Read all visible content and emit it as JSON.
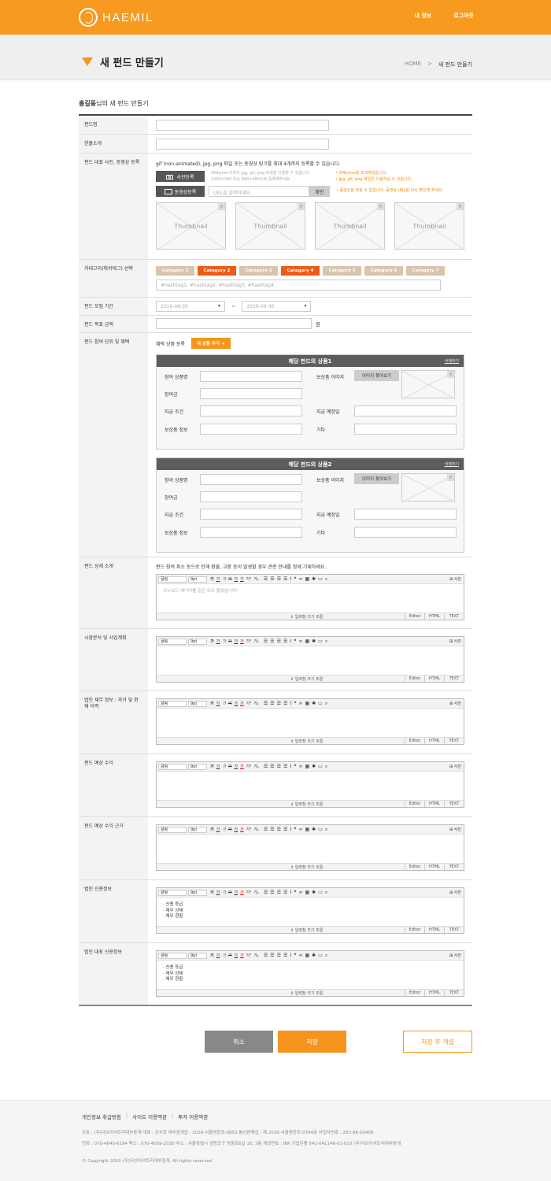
{
  "header": {
    "logo": "HAEMIL",
    "nav": [
      "내 정보",
      "로그아웃"
    ]
  },
  "titlebar": {
    "title": "새 펀드 만들기",
    "breadcrumb": [
      "HOME",
      ">",
      "새 펀드 만들기"
    ]
  },
  "form": {
    "heading_name": "홍길동",
    "heading_suffix": "님의 새 펀드 만들기"
  },
  "labels": {
    "fund_name": "펀드명",
    "one_line": "한줄소개",
    "media": "펀드 대표 사진, 동영상 등록",
    "category": "카테고리(해쉬태그) 선택",
    "period": "펀드 모집 기간",
    "goal": "펀드 목표 금액",
    "unit": "펀드 참여 단위 및 혜택",
    "detail": "펀드 상세 소개",
    "market": "시장분석 및 사업계획",
    "finance": "법인 재무 정보 : 과거 및 현재 이력",
    "yield": "펀드 예상 수익",
    "yield_basis": "펀드 예상 수익 근거",
    "credit": "법인 신용정보",
    "ceo_credit": "법인 대표 신용정보"
  },
  "media": {
    "notice": "gif (non-animated), jpg, png 파일 또는 동영상 링크를 최대 4개까지 등록할 수 있습니다.",
    "photo_btn": "사진등록",
    "photo_hint1": "2Mbytes 이하의 jpg, gif, png 파일을 이용할 수 있습니다.",
    "photo_hint2": "1000×300 또는 640×480으로 등록해주세요.",
    "photo_warn1": "• 2Mbytes를 초과하였습니다.",
    "photo_warn2": "• Jpg, gif, png 파일만 이용하실 수 있습니다.",
    "video_btn": "동영상등록",
    "video_placeholder": "URL을 입력하세요.",
    "video_confirm": "확인",
    "video_warn": "• 동영상을 찾을 수 없습니다. 동영상 URL을 다시 확인해 주세요.",
    "thumb": "Thumbnail"
  },
  "categories": [
    {
      "label": "Category 1",
      "on": false
    },
    {
      "label": "Category 2",
      "on": true
    },
    {
      "label": "Category 3",
      "on": false
    },
    {
      "label": "Category 4",
      "on": true
    },
    {
      "label": "Category 5",
      "on": false
    },
    {
      "label": "Category 6",
      "on": false
    },
    {
      "label": "Category 7",
      "on": false
    }
  ],
  "hashtags": "#hashtag1, #hashtag2, #hashtag3, #hashtag4",
  "period": {
    "start": "2016-08-30",
    "sep": "~",
    "end": "2016-09-30"
  },
  "goal": {
    "unit": "원"
  },
  "reward": {
    "register": "혜택 상품 등록",
    "add_btn": "새 상품 추가 +",
    "items": [
      "해당 펀드의 상품1",
      "해당 펀드의 상품2"
    ],
    "del": "삭제하기",
    "name": "참여 상품명",
    "image": "보상품 이미지",
    "find_img": "이미지 찾아보기",
    "amount": "참여금",
    "condition": "지급 조건",
    "date": "지급 예정일",
    "info": "보상품 정보",
    "etc": "기타"
  },
  "detail_notice": "펀드 참여 취소 등으로 인해 환불, 교환 등이 발생할 경우 관련 안내를 함께 기재하세요.",
  "editor": {
    "font": "굴림",
    "size": "9pt",
    "bold": "가",
    "under": "가",
    "ital": "가",
    "strike": "가",
    "color": "가",
    "bg": "가",
    "sup": "가²",
    "sub": "가₂",
    "photo": "사진",
    "resize": "⇕ 입력창 크기 조절",
    "tabs": [
      "Editor",
      "HTML",
      "TEXT"
    ],
    "placeholder": "크누보드 에디터를 일단 모두 붙였습니다!"
  },
  "credit_items": "· 신용 등급\n· 재무 상태\n· 채무 현황",
  "buttons": {
    "cancel": "취소",
    "save": "저장",
    "save_open": "저장 후 개설"
  },
  "footer": {
    "links": [
      "개인정보 취급방침",
      "사이트 이용약관",
      "투자 이용약관"
    ],
    "line1": "상호 : (주)다브어셔트리대부중개   대표 : 김숙희   대부중개업 : 2016-서울영등포-0853   통신판매업 : 제 2016-서울영등포-0764호   사업자번호 : 283-88-00409",
    "line2": "전화 : 070-4640-6194   팩스 : 070-4009-2030   주소 : 서울특별시 영등포구 영중로6길 16, 3층   계좌번호 : IBK 기업은행 541-041146-01-010 (주)다브어셔트리대부중개",
    "copy": "© Copyright 2016 (주)다브어셔트리대부중개. All rights reserved"
  }
}
